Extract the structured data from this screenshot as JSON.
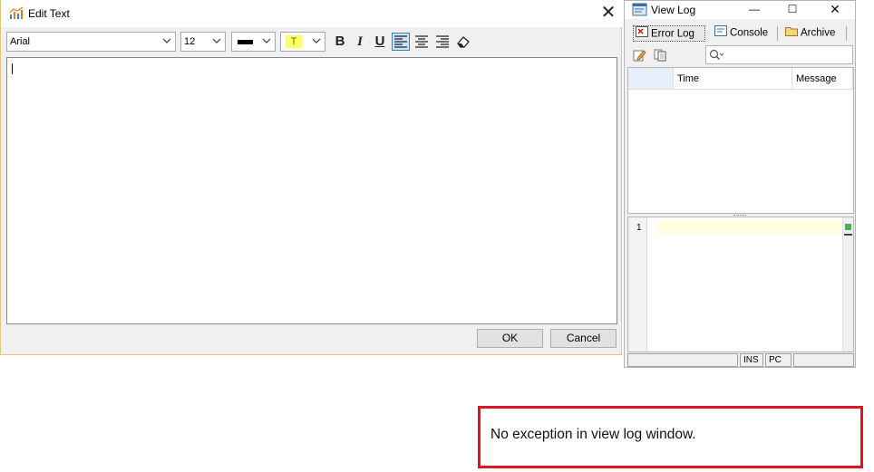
{
  "edit_window": {
    "title": "Edit Text",
    "toolbar": {
      "font_family": "Arial",
      "font_size": "12",
      "bold_label": "B",
      "italic_label": "I",
      "underline_label": "U",
      "highlight_glyph": "T",
      "text_color": "#000000",
      "highlight_color": "#ffff66",
      "active_alignment": "align-left"
    },
    "editor_text": "",
    "ok_label": "OK",
    "cancel_label": "Cancel"
  },
  "log_window": {
    "title": "View Log",
    "tabs": [
      {
        "label": "Error Log",
        "selected": true
      },
      {
        "label": "Console",
        "selected": false
      },
      {
        "label": "Archive",
        "selected": false
      }
    ],
    "columns": [
      "",
      "Time",
      "Message"
    ],
    "detail_line_number": "1",
    "status": {
      "ins": "INS",
      "pc": "PC"
    }
  },
  "annotation": {
    "text": "No exception in view log window.",
    "border_color": "#e0151f"
  }
}
